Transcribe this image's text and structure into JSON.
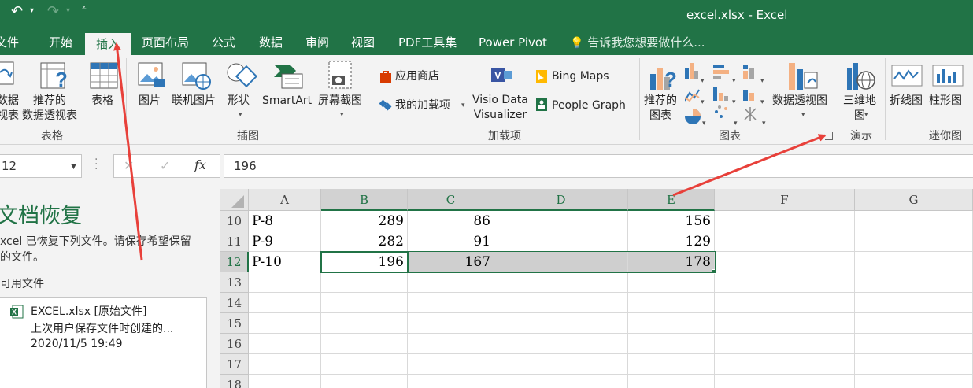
{
  "window": {
    "title": "excel.xlsx - Excel"
  },
  "tabs": [
    {
      "label": "文件"
    },
    {
      "label": "开始"
    },
    {
      "label": "插入"
    },
    {
      "label": "页面布局"
    },
    {
      "label": "公式"
    },
    {
      "label": "数据"
    },
    {
      "label": "审阅"
    },
    {
      "label": "视图"
    },
    {
      "label": "PDF工具集"
    },
    {
      "label": "Power Pivot"
    }
  ],
  "tell_me": "告诉我您想要做什么...",
  "ribbon": {
    "pivot_table": {
      "line1": "数据",
      "line2": "视表"
    },
    "recommended_pivot": {
      "line1": "推荐的",
      "line2": "数据透视表"
    },
    "table": "表格",
    "group_tables": "表格",
    "picture": "图片",
    "online_picture": "联机图片",
    "shapes": "形状",
    "smartart": "SmartArt",
    "screenshot": "屏幕截图",
    "group_illustrations": "插图",
    "store": "应用商店",
    "my_addins": "我的加载项",
    "visio": {
      "line1": "Visio Data",
      "line2": "Visualizer"
    },
    "bing_maps": "Bing Maps",
    "people_graph": "People Graph",
    "group_addins": "加载项",
    "recommended_charts": {
      "line1": "推荐的",
      "line2": "图表"
    },
    "pivot_chart": "数据透视图",
    "group_charts": "图表",
    "map_3d": {
      "line1": "三维地",
      "line2": "图"
    },
    "group_tours": "演示",
    "line_sparkline": "折线图",
    "column_sparkline": "柱形图",
    "group_sparklines": "迷你图"
  },
  "formula_bar": {
    "name_box": "12",
    "fx": "fx",
    "value": "196"
  },
  "recovery": {
    "title": "文档恢复",
    "description": "xcel 已恢复下列文件。请保存希望保留\n的文件。",
    "available": "可用文件",
    "file_name": "EXCEL.xlsx  [原始文件]",
    "file_note": "上次用户保存文件时创建的...",
    "file_time": "2020/11/5 19:49"
  },
  "grid": {
    "columns": [
      "A",
      "B",
      "C",
      "D",
      "E",
      "F",
      "G"
    ],
    "rows": [
      {
        "num": "10",
        "cells": [
          "P-8",
          "289",
          "86",
          "",
          "156",
          "",
          ""
        ]
      },
      {
        "num": "11",
        "cells": [
          "P-9",
          "282",
          "91",
          "",
          "129",
          "",
          ""
        ]
      },
      {
        "num": "12",
        "cells": [
          "P-10",
          "196",
          "167",
          "",
          "178",
          "",
          ""
        ]
      },
      {
        "num": "13",
        "cells": [
          "",
          "",
          "",
          "",
          "",
          "",
          ""
        ]
      },
      {
        "num": "14",
        "cells": [
          "",
          "",
          "",
          "",
          "",
          "",
          ""
        ]
      },
      {
        "num": "15",
        "cells": [
          "",
          "",
          "",
          "",
          "",
          "",
          ""
        ]
      },
      {
        "num": "16",
        "cells": [
          "",
          "",
          "",
          "",
          "",
          "",
          ""
        ]
      },
      {
        "num": "17",
        "cells": [
          "",
          "",
          "",
          "",
          "",
          "",
          ""
        ]
      },
      {
        "num": "18",
        "cells": [
          "",
          "",
          "",
          "",
          "",
          "",
          ""
        ]
      }
    ]
  },
  "colors": {
    "excel_green": "#217346",
    "annotation_red": "#e8403a"
  }
}
